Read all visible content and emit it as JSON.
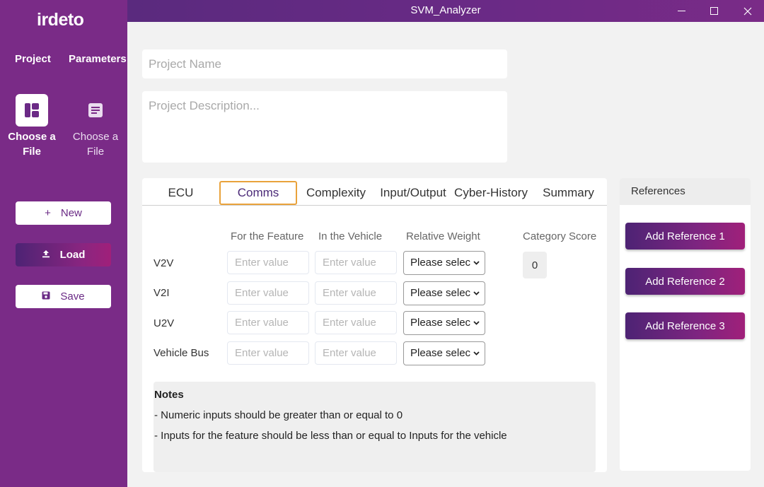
{
  "window": {
    "title": "SVM_Analyzer",
    "controls": {
      "minimize": "─",
      "maximize": "☐",
      "close": "✕"
    }
  },
  "sidebar": {
    "logo": "irdeto",
    "nav": [
      "Project",
      "Parameters"
    ],
    "file_tiles": [
      {
        "label_line1": "Choose a",
        "label_line2": "File",
        "icon": "dashboard-icon"
      },
      {
        "label_line1": "Choose a",
        "label_line2": "File",
        "icon": "document-icon"
      }
    ],
    "buttons": {
      "new": {
        "label": "New",
        "glyph": "+"
      },
      "load": {
        "label": "Load",
        "glyph": "⬆"
      },
      "save": {
        "label": "Save",
        "glyph": "💾"
      }
    }
  },
  "project": {
    "name_placeholder": "Project Name",
    "description_placeholder": "Project Description..."
  },
  "tabs": [
    "ECU",
    "Comms",
    "Complexity",
    "Input/Output",
    "Cyber-History",
    "Summary"
  ],
  "active_tab": "Comms",
  "comms": {
    "columns": [
      "For the Feature",
      "In the Vehicle",
      "Relative Weight",
      "Category Score"
    ],
    "input_placeholder": "Enter value",
    "select_placeholder": "Please selec",
    "rows": [
      "V2V",
      "V2I",
      "U2V",
      "Vehicle Bus"
    ],
    "category_score": "0"
  },
  "notes": {
    "heading": "Notes",
    "lines": [
      "- Numeric inputs should be greater than or equal to 0",
      "- Inputs for the feature should be less than or equal to Inputs for the vehicle"
    ]
  },
  "references": {
    "heading": "References",
    "buttons": [
      "Add Reference 1",
      "Add Reference 2",
      "Add Reference 3"
    ]
  },
  "colors": {
    "sidebar": "#7a2b87",
    "accent_tab_border": "#e9a23b",
    "button_gradient_start": "#4d2374",
    "button_gradient_end": "#a0207a"
  }
}
